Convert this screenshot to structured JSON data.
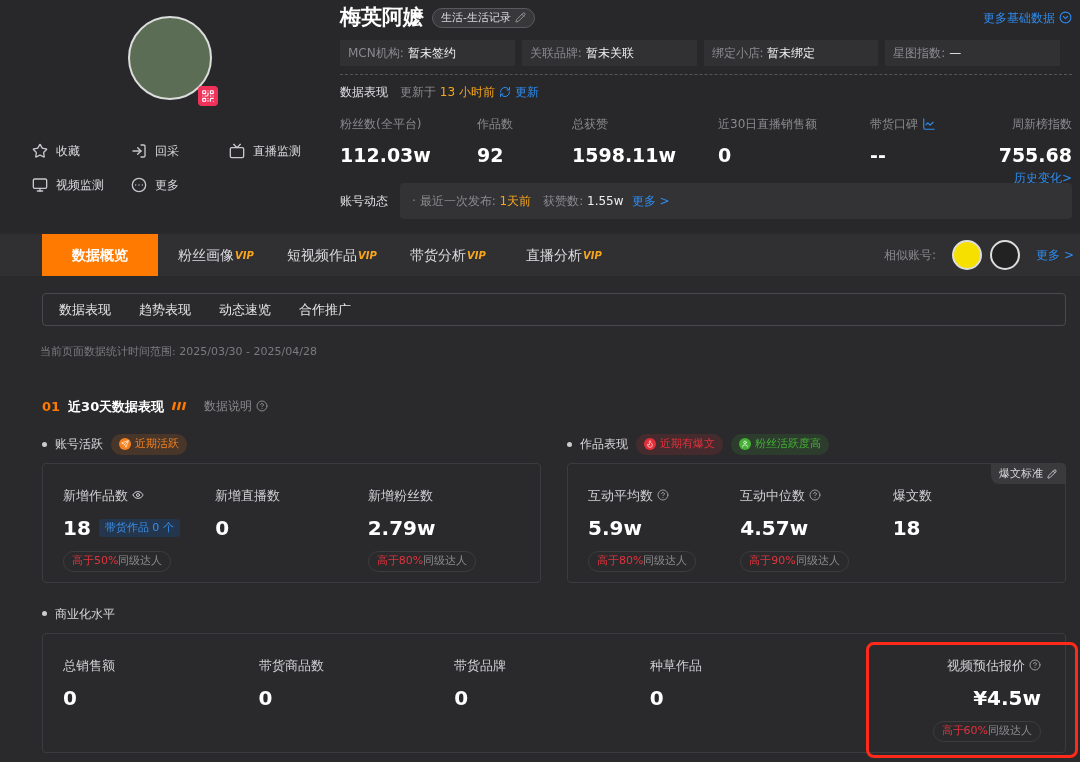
{
  "profile": {
    "name": "梅英阿嬷",
    "category": "生活-生活记录",
    "more_basic": "更多基础数据",
    "info_fields": [
      {
        "label": "MCN机构:",
        "value": "暂未签约"
      },
      {
        "label": "关联品牌:",
        "value": "暂未关联"
      },
      {
        "label": "绑定小店:",
        "value": "暂未绑定"
      },
      {
        "label": "星图指数:",
        "value": "—"
      }
    ],
    "actions": [
      {
        "kind": "star",
        "label": "收藏"
      },
      {
        "kind": "fetch",
        "label": "回采"
      },
      {
        "kind": "live",
        "label": "直播监测"
      },
      {
        "kind": "video",
        "label": "视频监测"
      },
      {
        "kind": "more",
        "label": "更多"
      }
    ]
  },
  "data_header": {
    "title": "数据表现",
    "updated_prefix": "更新于",
    "updated_time": "13 小时前",
    "refresh": "更新"
  },
  "stats": [
    {
      "label": "粉丝数(全平台)",
      "value": "112.03w"
    },
    {
      "label": "作品数",
      "value": "92"
    },
    {
      "label": "总获赞",
      "value": "1598.11w"
    },
    {
      "label": "近30日直播销售额",
      "value": "0"
    },
    {
      "label": "带货口碑",
      "value": "--",
      "trend_icon": true
    },
    {
      "label": "周新榜指数",
      "value": "755.68",
      "link": "历史变化>"
    }
  ],
  "activity": {
    "label": "账号动态",
    "last_label": "· 最近一次发布:",
    "last_value": "1天前",
    "likes_label": "获赞数:",
    "likes_value": "1.55w",
    "more": "更多 >"
  },
  "tabs": [
    {
      "label": "数据概览",
      "selected": true
    },
    {
      "label": "粉丝画像",
      "vip": "VIP",
      "selected": false
    },
    {
      "label": "短视频作品",
      "vip": "VIP",
      "selected": false
    },
    {
      "label": "带货分析",
      "vip": "VIP",
      "selected": false
    },
    {
      "label": "直播分析",
      "vip": "VIP",
      "selected": false
    }
  ],
  "similar": {
    "label": "相似账号:",
    "more": "更多 >"
  },
  "subtabs": [
    {
      "label": "数据表现"
    },
    {
      "label": "趋势表现"
    },
    {
      "label": "动态速览"
    },
    {
      "label": "合作推广"
    }
  ],
  "date_range": "当前页面数据统计时间范围: 2025/03/30 - 2025/04/28",
  "section": {
    "index": "01",
    "title": "近30天数据表现",
    "explain": "数据说明"
  },
  "groups": [
    {
      "title": "账号活跃",
      "tags": [
        {
          "label": "近期活跃",
          "color": "#f5821f"
        }
      ],
      "metrics": [
        {
          "label": "新增作品数",
          "eye": true,
          "value": "18",
          "badge": "带货作品 0 个",
          "rank_high": "高于50%",
          "rank_rest": "同级达人"
        },
        {
          "label": "新增直播数",
          "value": "0"
        },
        {
          "label": "新增粉丝数",
          "value": "2.79w",
          "rank_high": "高于80%",
          "rank_rest": "同级达人"
        }
      ]
    },
    {
      "title": "作品表现",
      "tags": [
        {
          "label": "近期有爆文",
          "color": "#e5303a"
        },
        {
          "label": "粉丝活跃度高",
          "color": "#45b035"
        }
      ],
      "corner": "爆文标准",
      "metrics": [
        {
          "label": "互动平均数",
          "help": true,
          "value": "5.9w",
          "rank_high": "高于80%",
          "rank_rest": "同级达人"
        },
        {
          "label": "互动中位数",
          "help": true,
          "value": "4.57w",
          "rank_high": "高于90%",
          "rank_rest": "同级达人"
        },
        {
          "label": "爆文数",
          "value": "18"
        }
      ]
    }
  ],
  "commercial": {
    "title": "商业化水平",
    "metrics": [
      {
        "label": "总销售额",
        "value": "0"
      },
      {
        "label": "带货商品数",
        "value": "0"
      },
      {
        "label": "带货品牌",
        "value": "0"
      },
      {
        "label": "种草作品",
        "value": "0"
      },
      {
        "label": "视频预估报价",
        "help": true,
        "value": "¥4.5w",
        "rank_high": "高于60%",
        "rank_rest": "同级达人",
        "highlighted": true
      }
    ]
  }
}
